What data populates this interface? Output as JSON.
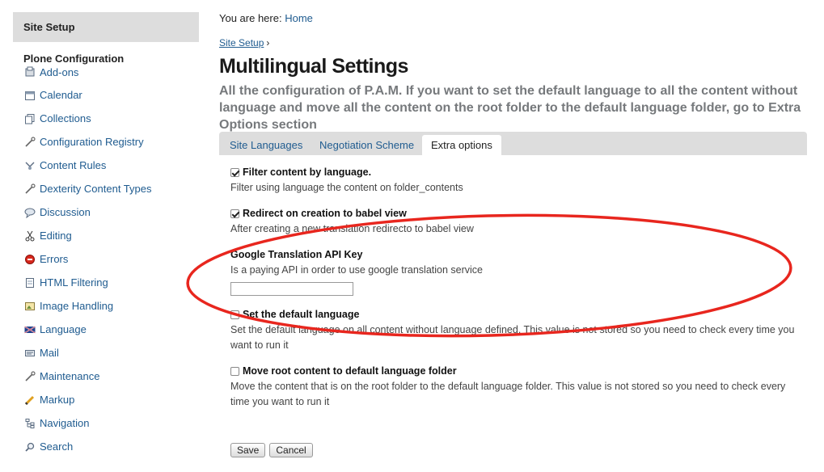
{
  "sidebar": {
    "header": "Site Setup",
    "group_title": "Plone Configuration",
    "items": [
      {
        "label": "Add-ons",
        "icon": "addons-icon"
      },
      {
        "label": "Calendar",
        "icon": "calendar-icon"
      },
      {
        "label": "Collections",
        "icon": "collections-icon"
      },
      {
        "label": "Configuration Registry",
        "icon": "wrench-icon"
      },
      {
        "label": "Content Rules",
        "icon": "content-rules-icon"
      },
      {
        "label": "Dexterity Content Types",
        "icon": "wrench-icon"
      },
      {
        "label": "Discussion",
        "icon": "discussion-icon"
      },
      {
        "label": "Editing",
        "icon": "scissors-icon"
      },
      {
        "label": "Errors",
        "icon": "error-icon"
      },
      {
        "label": "HTML Filtering",
        "icon": "html-filter-icon"
      },
      {
        "label": "Image Handling",
        "icon": "image-icon"
      },
      {
        "label": "Language",
        "icon": "flag-icon"
      },
      {
        "label": "Mail",
        "icon": "mail-icon"
      },
      {
        "label": "Maintenance",
        "icon": "wrench-icon"
      },
      {
        "label": "Markup",
        "icon": "pencil-icon"
      },
      {
        "label": "Navigation",
        "icon": "navigation-icon"
      },
      {
        "label": "Search",
        "icon": "search-icon"
      }
    ]
  },
  "breadcrumb": {
    "prefix": "You are here:",
    "home": "Home",
    "parent": "Site Setup",
    "separator": "›"
  },
  "page": {
    "title": "Multilingual Settings",
    "description": "All the configuration of P.A.M. If you want to set the default language to all the content without language and move all the content on the root folder to the default language folder, go to Extra Options section"
  },
  "tabs": [
    {
      "label": "Site Languages",
      "active": false
    },
    {
      "label": "Negotiation Scheme",
      "active": false
    },
    {
      "label": "Extra options",
      "active": true
    }
  ],
  "fields": {
    "filter": {
      "label": "Filter content by language.",
      "help": "Filter using language the content on folder_contents",
      "checked": true
    },
    "redirect": {
      "label": "Redirect on creation to babel view",
      "help": "After creating a new translation redirecto to babel view",
      "checked": true
    },
    "google": {
      "label": "Google Translation API Key",
      "help": "Is a paying API in order to use google translation service",
      "value": ""
    },
    "default_lang": {
      "label": "Set the default language",
      "help": "Set the default language on all content without language defined. This value is not stored so you need to check every time you want to run it",
      "checked": false
    },
    "move_root": {
      "label": "Move root content to default language folder",
      "help": "Move the content that is on the root folder to the default language folder. This value is not stored so you need to check every time you want to run it",
      "checked": false
    }
  },
  "buttons": {
    "save": "Save",
    "cancel": "Cancel"
  },
  "colors": {
    "link": "#205c90",
    "annotation": "#e8261e",
    "sidebar_header_bg": "#dddddd",
    "description": "#76797c"
  }
}
